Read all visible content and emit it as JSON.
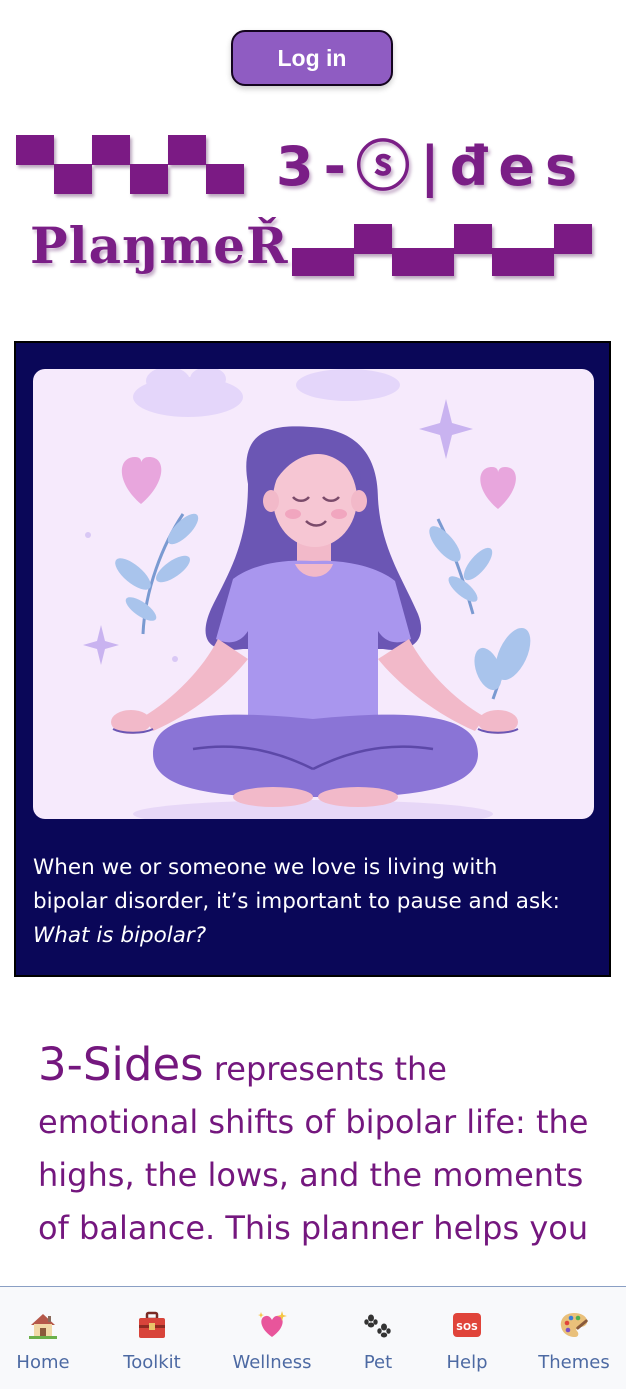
{
  "header": {
    "login_label": "Log in"
  },
  "logo": {
    "line1": "3-ⓢ|đes",
    "line2": "PlaŋmeŘ",
    "color": "#7a1e86"
  },
  "hero": {
    "image_icon": "meditating-woman-illustration",
    "caption_line1": "When we or someone we love is living with",
    "caption_line2": "bipolar disorder, it’s important to pause and ask:",
    "caption_question": "What is bipolar?",
    "background": "#0a0758"
  },
  "intro": {
    "brand": "3-Sides",
    "text1": " represents the",
    "text2": "emotional shifts of bipolar life: the highs, the lows, and the moments of balance. This planner helps you",
    "text_color": "#74177e"
  },
  "nav": {
    "items": [
      {
        "label": "Home",
        "icon": "house-icon"
      },
      {
        "label": "Toolkit",
        "icon": "toolbox-icon"
      },
      {
        "label": "Wellness",
        "icon": "sparkling-heart-icon"
      },
      {
        "label": "Pet",
        "icon": "paw-prints-icon"
      },
      {
        "label": "Help",
        "icon": "sos-icon"
      },
      {
        "label": "Themes",
        "icon": "palette-icon"
      }
    ]
  }
}
